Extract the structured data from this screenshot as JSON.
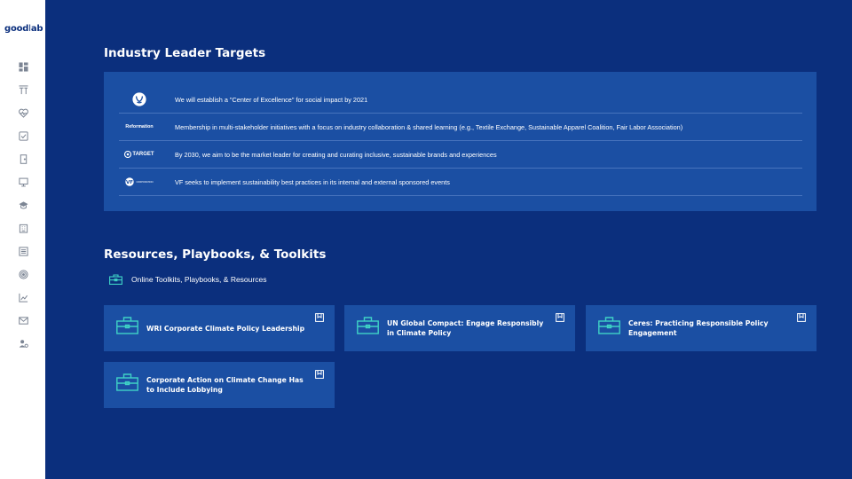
{
  "app": {
    "logo_text": "good lab"
  },
  "sidebar": {
    "items": [
      {
        "icon": "dashboard-icon"
      },
      {
        "icon": "text-format-icon"
      },
      {
        "icon": "heart-pulse-icon"
      },
      {
        "icon": "checkbox-icon"
      },
      {
        "icon": "door-icon"
      },
      {
        "icon": "monitor-icon"
      },
      {
        "icon": "graduation-cap-icon"
      },
      {
        "icon": "building-icon"
      },
      {
        "icon": "list-icon"
      },
      {
        "icon": "target-icon"
      },
      {
        "icon": "chart-icon"
      },
      {
        "icon": "mail-icon"
      },
      {
        "icon": "users-icon"
      }
    ]
  },
  "industry": {
    "title": "Industry Leader Targets",
    "rows": [
      {
        "company": "lululemon",
        "logo_text": "",
        "text": "We will establish a \"Center of Excellence\" for social impact by 2021"
      },
      {
        "company": "Reformation",
        "logo_text": "Reformation",
        "text": "Membership in multi-stakeholder initiatives with a focus on industry collaboration & shared learning (e.g., Textile Exchange, Sustainable Apparel Coalition, Fair Labor Association)"
      },
      {
        "company": "Target",
        "logo_text": "TARGET",
        "text": "By 2030, we aim to be the market leader for creating and curating inclusive, sustainable brands and experiences"
      },
      {
        "company": "VF",
        "logo_text": "CORPORATION",
        "text": "VF seeks to implement sustainability best practices in its internal and external sponsored events"
      }
    ]
  },
  "resources": {
    "title": "Resources, Playbooks, & Toolkits",
    "link_label": "Online Toolkits, Playbooks, & Resources",
    "cards": [
      {
        "title": "WRI Corporate Climate Policy Leadership"
      },
      {
        "title": "UN Global Compact: Engage Responsibly in Climate Policy"
      },
      {
        "title": "Ceres: Practicing Responsible Policy Engagement"
      },
      {
        "title": "Corporate Action on Climate Change Has to Include Lobbying"
      }
    ]
  },
  "colors": {
    "background": "#0b2f7d",
    "panel": "#1b4fa3",
    "accent": "#3fd3c6",
    "sidebar": "#ffffff"
  }
}
